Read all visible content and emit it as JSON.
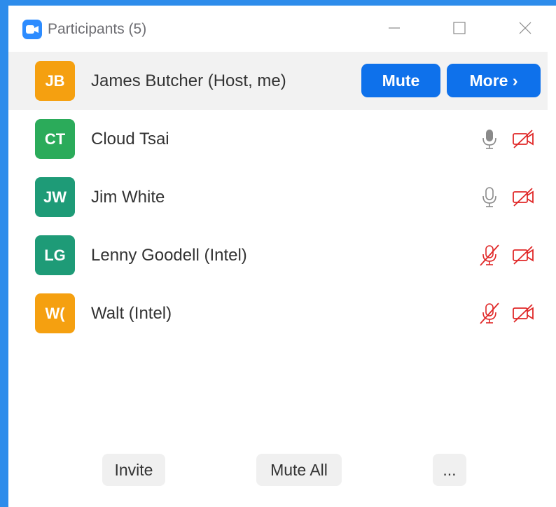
{
  "window": {
    "title": "Participants (5)",
    "app_icon": "zoom-camera-icon"
  },
  "colors": {
    "accent_blue": "#0e71eb",
    "muted_red": "#e02828",
    "avatar_orange": "#f5a010",
    "avatar_green": "#2bab5a",
    "avatar_teal": "#1e9b77"
  },
  "participants": [
    {
      "initials": "JB",
      "name": "James Butcher (Host, me)",
      "avatar_color": "#f5a010",
      "host": true
    },
    {
      "initials": "CT",
      "name": "Cloud Tsai",
      "avatar_color": "#2bab5a",
      "mic": "on",
      "video": "off"
    },
    {
      "initials": "JW",
      "name": "Jim White",
      "avatar_color": "#1e9b77",
      "mic": "on",
      "video": "off"
    },
    {
      "initials": "LG",
      "name": "Lenny Goodell (Intel)",
      "avatar_color": "#1e9b77",
      "mic": "muted",
      "video": "off"
    },
    {
      "initials": "W(",
      "name": "Walt (Intel)",
      "avatar_color": "#f5a010",
      "mic": "muted",
      "video": "off"
    }
  ],
  "host_actions": {
    "mute_label": "Mute",
    "more_label": "More ›"
  },
  "footer": {
    "invite_label": "Invite",
    "mute_all_label": "Mute All",
    "more_label": "..."
  }
}
